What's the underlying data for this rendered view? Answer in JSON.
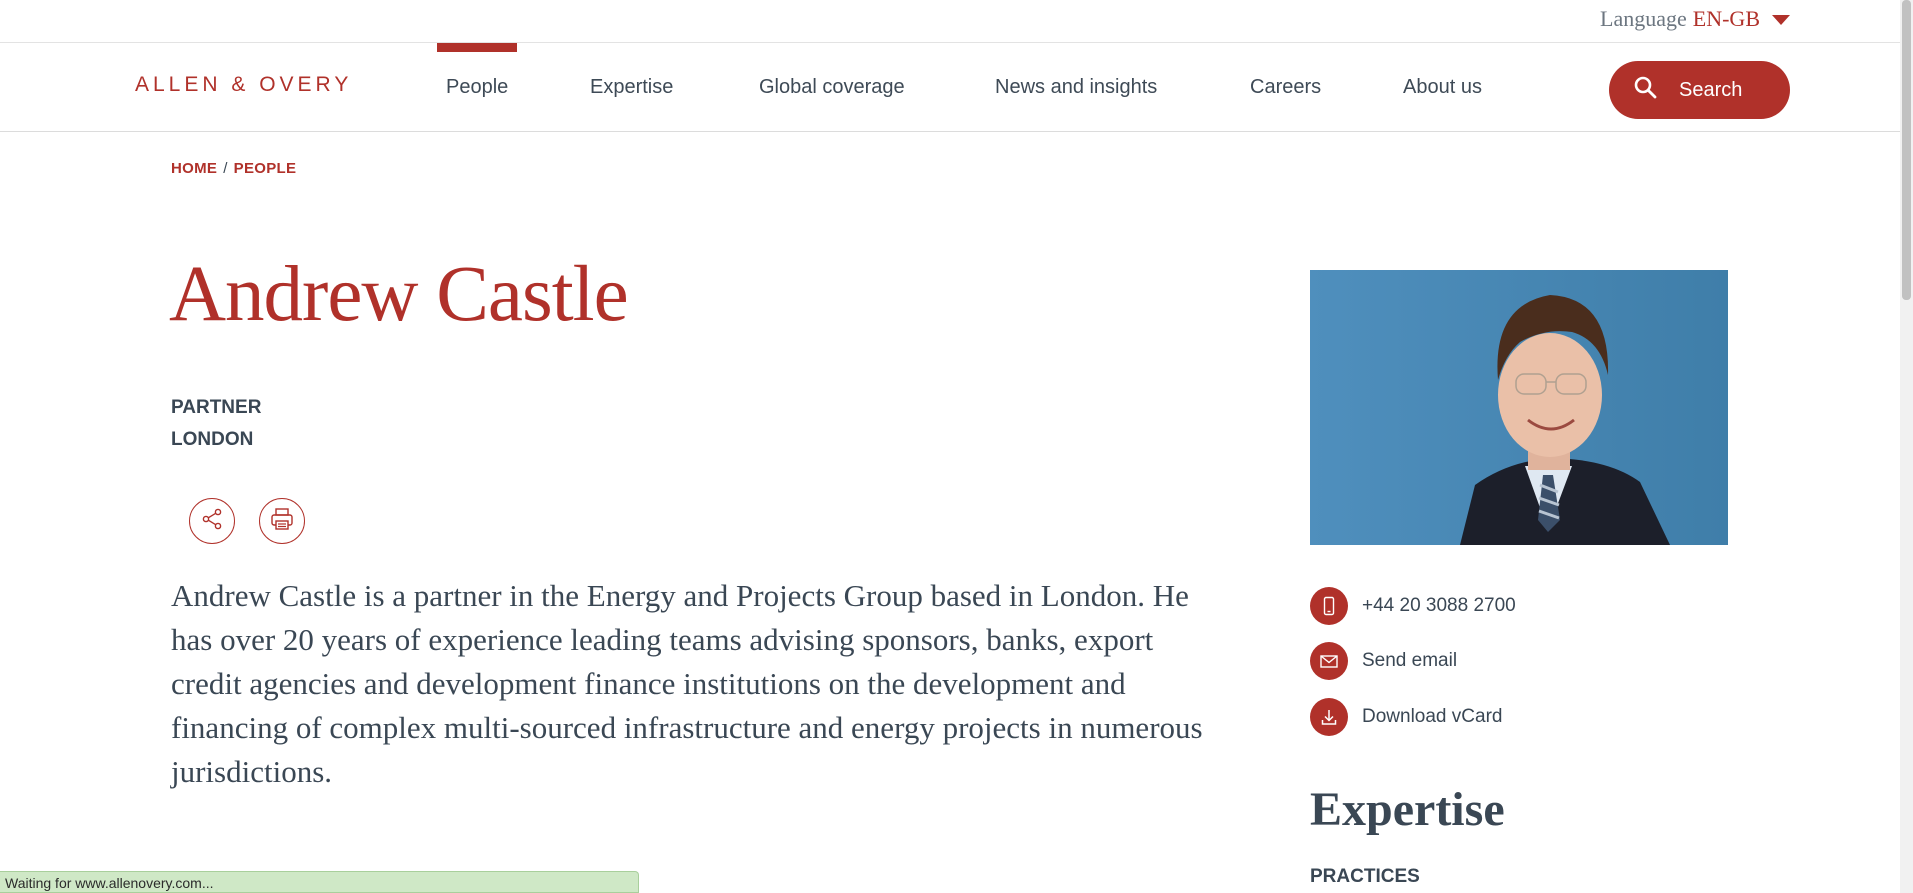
{
  "language": {
    "label": "Language",
    "value": "EN-GB"
  },
  "logo": "ALLEN & OVERY",
  "nav": {
    "items": [
      {
        "label": "People"
      },
      {
        "label": "Expertise"
      },
      {
        "label": "Global coverage"
      },
      {
        "label": "News and insights"
      },
      {
        "label": "Careers"
      },
      {
        "label": "About us"
      }
    ],
    "search_label": "Search"
  },
  "breadcrumb": {
    "home": "HOME",
    "separator": "/",
    "current": "PEOPLE"
  },
  "profile": {
    "name": "Andrew Castle",
    "title": "PARTNER",
    "location": "LONDON",
    "bio": "Andrew Castle is a partner in the Energy and Projects Group based in London. He has over 20 years of experience leading teams advising sponsors, banks, export credit agencies and development finance institutions on the development and financing of complex multi-sourced infrastructure and energy projects in numerous jurisdictions."
  },
  "contact": {
    "phone": "+44 20 3088 2700",
    "email_label": "Send email",
    "vcard_label": "Download vCard"
  },
  "expertise": {
    "heading": "Expertise",
    "practices_label": "PRACTICES"
  },
  "status_bar": "Waiting for www.allenovery.com...",
  "colors": {
    "brand": "#b0312a",
    "text": "#3a4754"
  },
  "icons": [
    "share-icon",
    "print-icon",
    "search-icon",
    "phone-icon",
    "email-icon",
    "download-icon",
    "caret-down-icon"
  ]
}
